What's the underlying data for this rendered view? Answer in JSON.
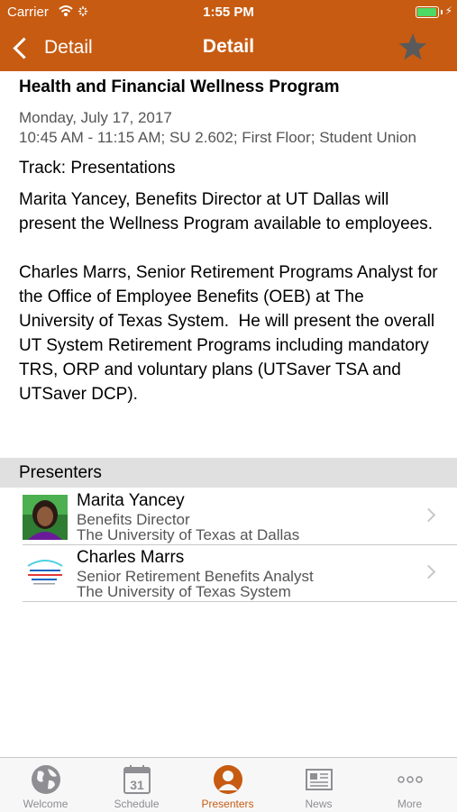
{
  "colors": {
    "accent": "#c75b12",
    "battery": "#4cd964",
    "tab_inactive": "#8e8e93"
  },
  "status_bar": {
    "carrier": "Carrier",
    "time": "1:55 PM"
  },
  "nav": {
    "back_label": "Detail",
    "title": "Detail",
    "favorite_icon": "star-icon"
  },
  "event": {
    "title": "Health and Financial Wellness Program",
    "date": "Monday, July 17, 2017",
    "time_location": "10:45 AM - 11:15 AM; SU 2.602; First Floor; Student Union",
    "track": "Track: Presentations",
    "description": "Marita Yancey, Benefits Director at UT Dallas will present the Wellness Program available to employees.\n\nCharles Marrs, Senior Retirement Programs Analyst for the Office of Employee Benefits (OEB) at The University of Texas System.  He will present the overall UT System Retirement Programs including mandatory TRS, ORP and voluntary plans (UTSaver TSA and UTSaver DCP)."
  },
  "presenters_header": "Presenters",
  "presenters": [
    {
      "name": "Marita Yancey",
      "role": "Benefits Director",
      "org": "The University of Texas at Dallas"
    },
    {
      "name": "Charles Marrs",
      "role": "Senior Retirement Benefits Analyst",
      "org": "The University of Texas System"
    }
  ],
  "tabs": [
    {
      "label": "Welcome",
      "icon": "globe-icon",
      "active": false
    },
    {
      "label": "Schedule",
      "icon": "calendar-icon",
      "active": false
    },
    {
      "label": "Presenters",
      "icon": "person-icon",
      "active": true
    },
    {
      "label": "News",
      "icon": "newspaper-icon",
      "active": false
    },
    {
      "label": "More",
      "icon": "more-icon",
      "active": false
    }
  ],
  "calendar_day": "31"
}
